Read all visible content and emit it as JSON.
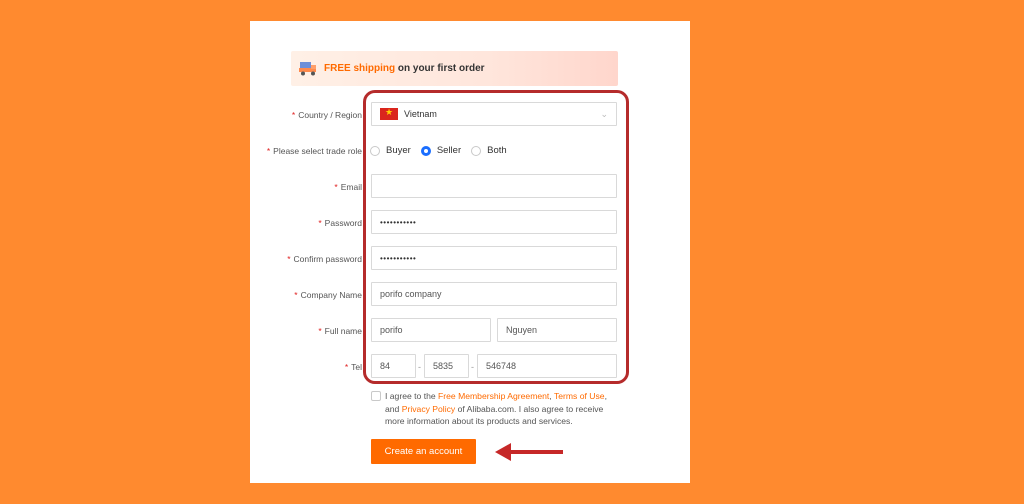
{
  "banner": {
    "free": "FREE shipping",
    "rest": " on your first order"
  },
  "form": {
    "country_label": "Country / Region",
    "country_value": "Vietnam",
    "role_label": "Please select trade role",
    "roles": [
      "Buyer",
      "Seller",
      "Both"
    ],
    "selected_role": "Seller",
    "email_label": "Email",
    "email_value": "",
    "password_label": "Password",
    "password_value": "•••••••••••",
    "confirm_label": "Confirm password",
    "confirm_value": "•••••••••••",
    "company_label": "Company Name",
    "company_value": "porifo company",
    "fullname_label": "Full name",
    "first_name": "porifo",
    "last_name": "Nguyen",
    "tel_label": "Tel",
    "tel_country": "84",
    "tel_area": "5835",
    "tel_number": "546748",
    "dash": "-"
  },
  "agreement": {
    "t1": "I agree to the ",
    "link1": "Free Membership Agreement",
    "t2": ", ",
    "link2": "Terms of Use",
    "t3": ", and ",
    "link3": "Privacy Policy",
    "t4": " of Alibaba.com. I also agree to receive more information about its products and services."
  },
  "button": {
    "create": "Create an account"
  },
  "colors": {
    "accent": "#ff6a00",
    "background": "#ff8a2f",
    "highlight": "#b52b2b",
    "radio": "#1a6eff"
  }
}
